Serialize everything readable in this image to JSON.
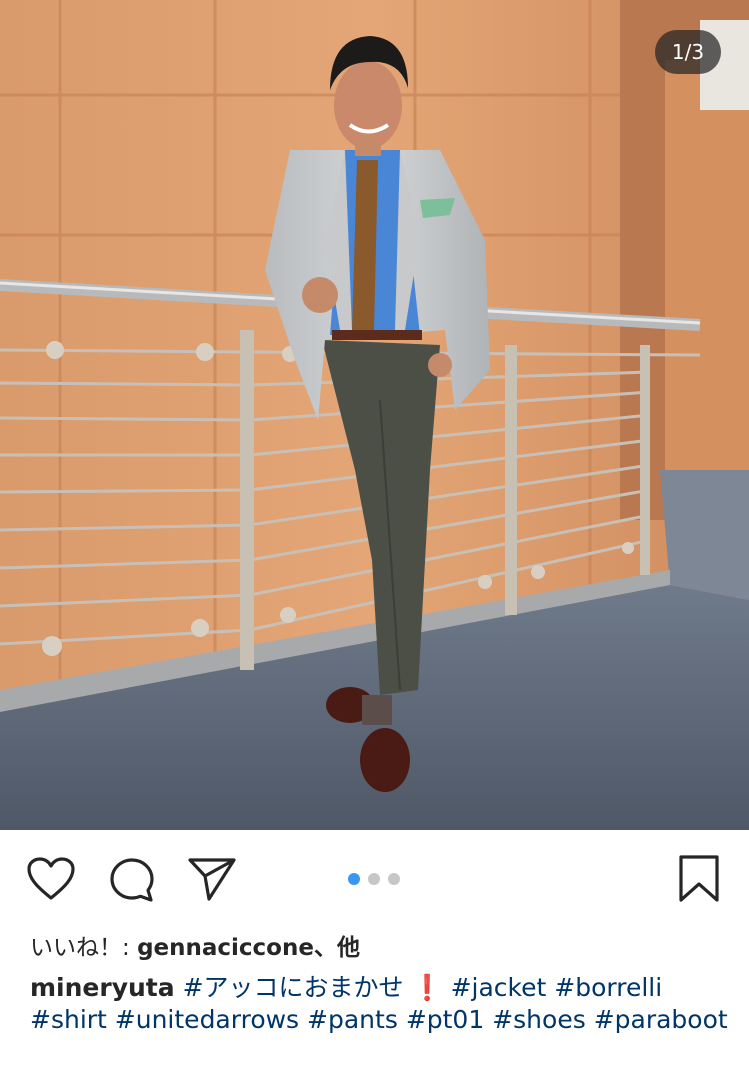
{
  "post": {
    "image_counter": "1/3",
    "image_description_icon": "photo-of-man-in-suit",
    "likes_prefix": "いいね！: ",
    "likes_user": "gennaciccone",
    "likes_suffix": "、他",
    "caption": {
      "username": "mineryuta",
      "parts": [
        "#アッコにおまかせ",
        "❗",
        "#jacket",
        "#borrelli",
        "#shirt",
        "#unitedarrows",
        "#pants",
        "#pt01",
        "#shoes",
        "#paraboot"
      ]
    },
    "carousel": {
      "count": 3,
      "active_index": 0
    }
  },
  "icons": {
    "like": "heart-icon",
    "comment": "comment-icon",
    "share": "send-icon",
    "save": "bookmark-icon"
  },
  "colors": {
    "accent_blue": "#3897f0",
    "hashtag": "#003569",
    "text": "#262626",
    "inactive_dot": "#c7c7c7"
  }
}
